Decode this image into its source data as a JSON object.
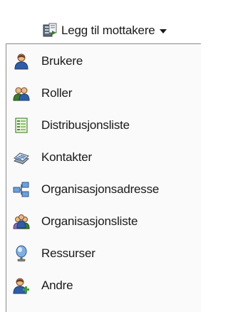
{
  "toolbar": {
    "add_recipients_label": "Legg til mottakere",
    "add_recipients_icon": "document-recipient-icon",
    "dropdown_icon": "chevron-down-icon"
  },
  "menu": {
    "items": [
      {
        "label": "Brukere",
        "icon": "user-icon"
      },
      {
        "label": "Roller",
        "icon": "users-group-icon"
      },
      {
        "label": "Distribusjonsliste",
        "icon": "list-sheet-icon"
      },
      {
        "label": "Kontakter",
        "icon": "contacts-card-icon"
      },
      {
        "label": "Organisasjonsadresse",
        "icon": "org-structure-icon"
      },
      {
        "label": "Organisasjonsliste",
        "icon": "org-group-icon"
      },
      {
        "label": "Ressurser",
        "icon": "microphone-resource-icon"
      },
      {
        "label": "Andre",
        "icon": "user-add-icon"
      }
    ]
  },
  "colors": {
    "menu_background": "#fafafa",
    "menu_border": "#8a8a8a",
    "text": "#1a1a1a"
  }
}
